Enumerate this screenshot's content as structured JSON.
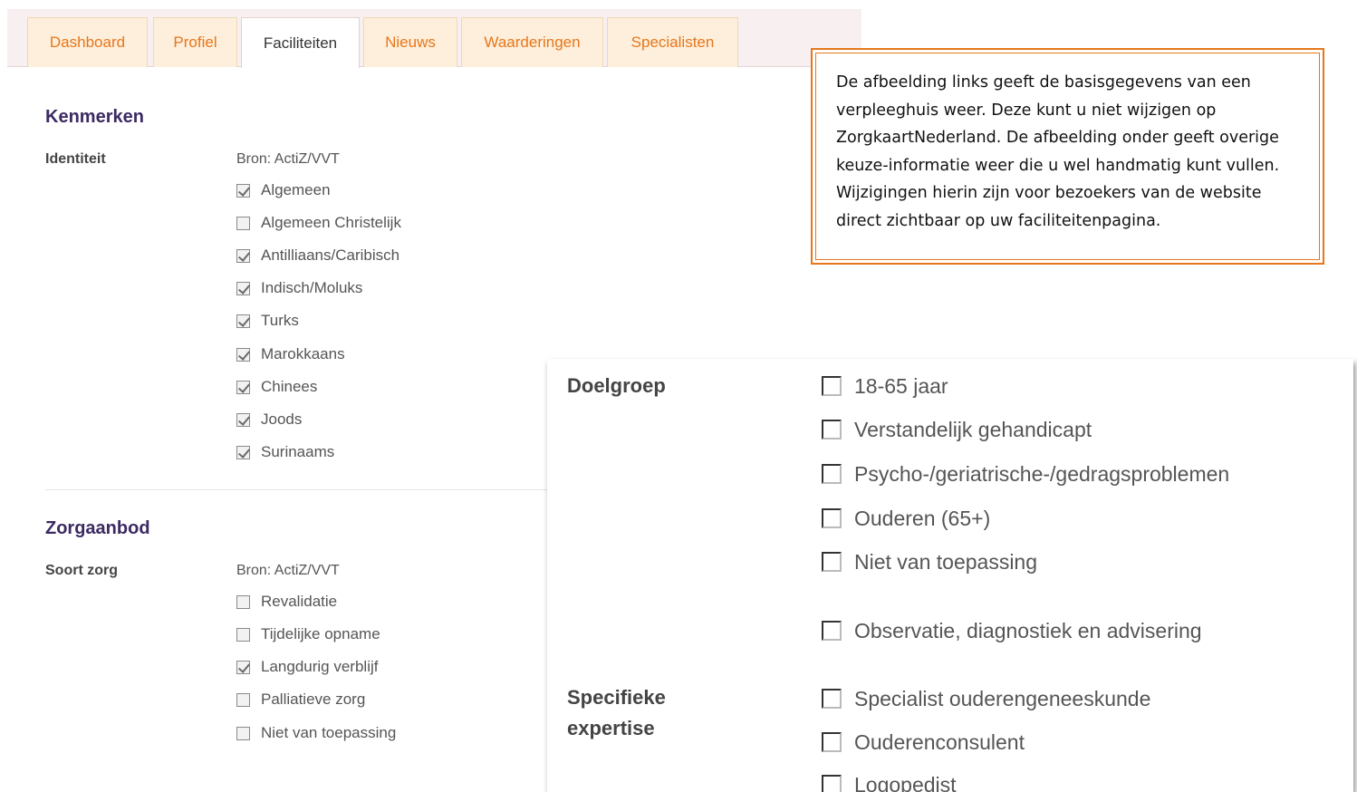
{
  "tabs": [
    {
      "label": "Dashboard",
      "active": false
    },
    {
      "label": "Profiel",
      "active": false
    },
    {
      "label": "Faciliteiten",
      "active": true
    },
    {
      "label": "Nieuws",
      "active": false
    },
    {
      "label": "Waarderingen",
      "active": false
    },
    {
      "label": "Specialisten",
      "active": false
    }
  ],
  "kenmerken": {
    "title": "Kenmerken",
    "row_label": "Identiteit",
    "source": "Bron: ActiZ/VVT",
    "options": [
      {
        "label": "Algemeen",
        "checked": true
      },
      {
        "label": "Algemeen Christelijk",
        "checked": false
      },
      {
        "label": "Antilliaans/Caribisch",
        "checked": true
      },
      {
        "label": "Indisch/Moluks",
        "checked": true
      },
      {
        "label": "Turks",
        "checked": true
      },
      {
        "label": "Marokkaans",
        "checked": true
      },
      {
        "label": "Chinees",
        "checked": true
      },
      {
        "label": "Joods",
        "checked": true
      },
      {
        "label": "Surinaams",
        "checked": true
      }
    ]
  },
  "zorgaanbod": {
    "title": "Zorgaanbod",
    "row_label": "Soort zorg",
    "source": "Bron: ActiZ/VVT",
    "options": [
      {
        "label": "Revalidatie",
        "checked": false
      },
      {
        "label": "Tijdelijke opname",
        "checked": false
      },
      {
        "label": "Langdurig verblijf",
        "checked": true
      },
      {
        "label": "Palliatieve zorg",
        "checked": false
      },
      {
        "label": "Niet van toepassing",
        "checked": false
      }
    ]
  },
  "note": {
    "text": "De afbeelding links geeft de basisgegevens van een verpleeghuis weer. Deze kunt u niet wijzigen op ZorgkaartNederland. De afbeelding onder geeft overige keuze-informatie weer die u wel handmatig kunt vullen. Wijzigingen hierin zijn voor bezoekers van de website direct zichtbaar op uw faciliteitenpagina."
  },
  "zoom": {
    "doelgroep_label": "Doelgroep",
    "doelgroep_options": [
      {
        "label": "18-65 jaar",
        "checked": false
      },
      {
        "label": "Verstandelijk gehandicapt",
        "checked": false
      },
      {
        "label": "Psycho-/geriatrische-/gedragsproblemen",
        "checked": false
      },
      {
        "label": "Ouderen (65+)",
        "checked": false
      },
      {
        "label": "Niet van toepassing",
        "checked": false
      }
    ],
    "extra_option": {
      "label": "Observatie, diagnostiek en advisering",
      "checked": false
    },
    "expertise_label_1": "Specifieke",
    "expertise_label_2": "expertise",
    "expertise_options": [
      {
        "label": "Specialist ouderengeneeskunde",
        "checked": false
      },
      {
        "label": "Ouderenconsulent",
        "checked": false
      },
      {
        "label": "Logopedist",
        "checked": false
      }
    ]
  }
}
